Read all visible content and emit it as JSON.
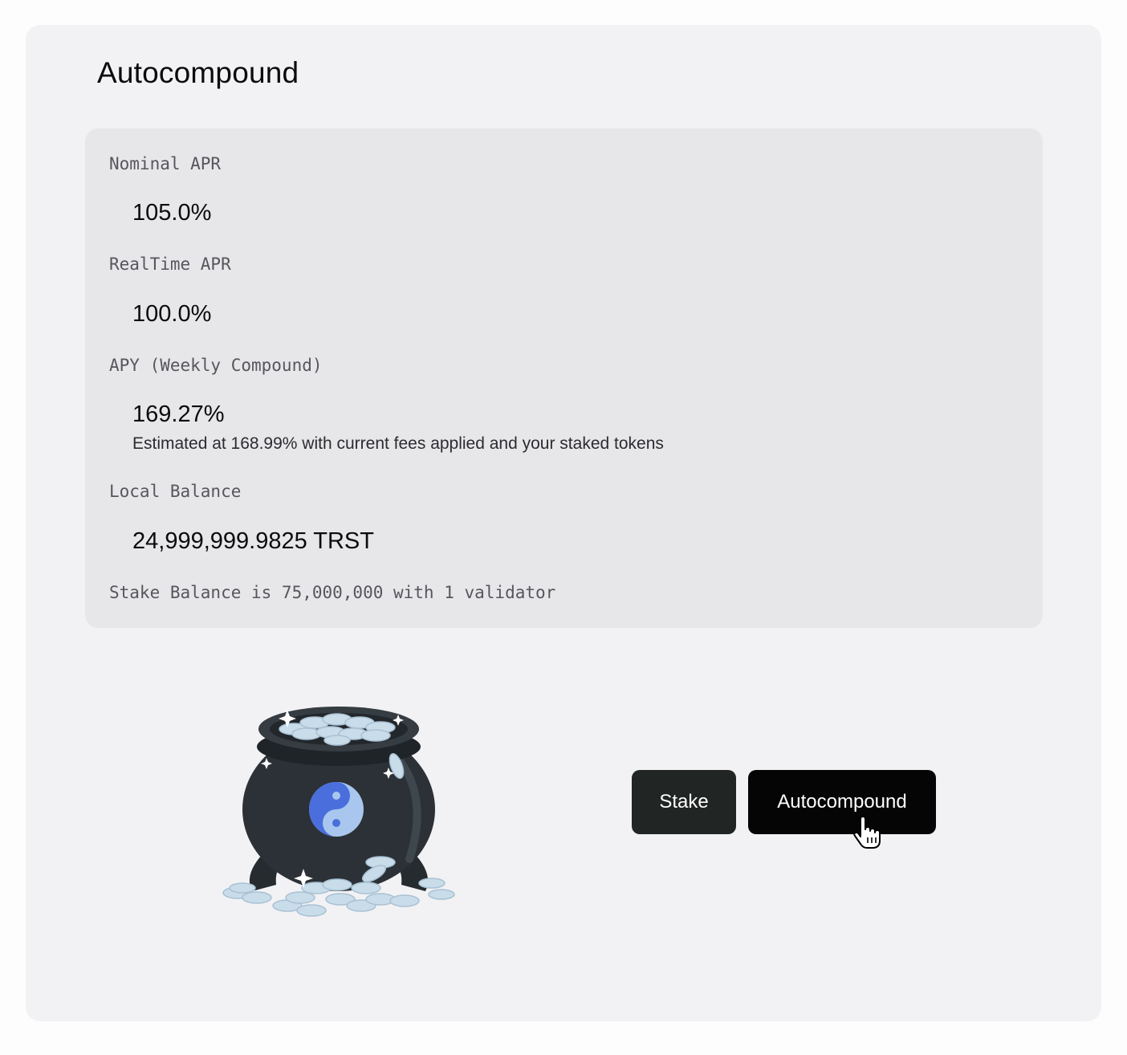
{
  "page": {
    "title": "Autocompound"
  },
  "stats": {
    "nominal_apr_label": "Nominal APR",
    "nominal_apr_value": "105.0%",
    "realtime_apr_label": "RealTime APR",
    "realtime_apr_value": "100.0%",
    "apy_label": "APY (Weekly Compound)",
    "apy_value": "169.27%",
    "apy_note": "Estimated at 168.99% with current fees applied and your staked tokens",
    "local_balance_label": "Local Balance",
    "local_balance_value": "24,999,999.9825 TRST",
    "stake_balance_text": "Stake Balance is 75,000,000 with 1 validator"
  },
  "actions": {
    "stake_label": "Stake",
    "autocompound_label": "Autocompound"
  },
  "colors": {
    "card_bg": "#f2f2f4",
    "stats_bg": "#e7e7ea",
    "stake_button": "#212524",
    "autocompound_button": "#050506",
    "logo_blue": "#4a6fdc",
    "coin": "#c9dcea"
  },
  "icons": {
    "illustration": "pot-of-coins-illustration",
    "cursor": "hand-pointer-icon"
  }
}
